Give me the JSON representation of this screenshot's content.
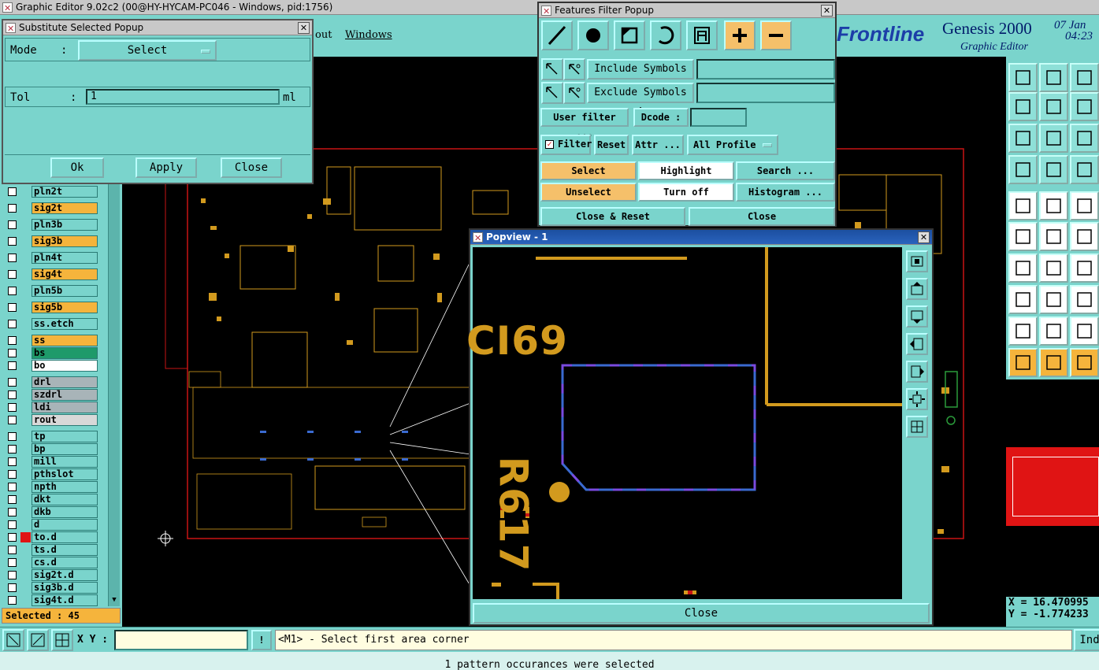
{
  "main_window": {
    "title": "Graphic Editor 9.02c2 (00@HY-HYCAM-PC046 - Windows, pid:1756)"
  },
  "menu": {
    "item_layout": "out",
    "item_windows": "Windows"
  },
  "brand": {
    "logo": "Frontline",
    "product": "Genesis 2000",
    "subtitle": "Graphic Editor",
    "date": "07 Jan",
    "time": "04:23"
  },
  "substitute_popup": {
    "title": "Substitute Selected Popup",
    "mode_label": "Mode",
    "mode_colon": ":",
    "mode_value": "Select",
    "tol_label": "Tol",
    "tol_colon": ":",
    "tol_value": "1",
    "tol_unit": "ml",
    "ok": "Ok",
    "apply": "Apply",
    "close": "Close"
  },
  "features_filter": {
    "title": "Features Filter Popup",
    "include_label": "Include Symbols :",
    "exclude_label": "Exclude Symbols :",
    "user_filter": "User filter ...",
    "dcode_label": "Dcode :",
    "filter_label": "Filter",
    "reset": "Reset",
    "attr": "Attr ...",
    "profile": "All Profile",
    "select": "Select",
    "highlight": "Highlight",
    "search": "Search ...",
    "unselect": "Unselect",
    "turn_off": "Turn off",
    "histogram": "Histogram ...",
    "close_reset": "Close & Reset",
    "close": "Close"
  },
  "popview": {
    "title": "Popview - 1",
    "label1": "CI69",
    "label2": "R617",
    "close": "Close"
  },
  "layers": [
    {
      "name": "pln2t",
      "color": "#7ad4cc"
    },
    {
      "name": "sig2t",
      "color": "#f5b43c"
    },
    {
      "name": "pln3b",
      "color": "#7ad4cc"
    },
    {
      "name": "sig3b",
      "color": "#f5b43c"
    },
    {
      "name": "pln4t",
      "color": "#7ad4cc"
    },
    {
      "name": "sig4t",
      "color": "#f5b43c"
    },
    {
      "name": "pln5b",
      "color": "#7ad4cc"
    },
    {
      "name": "sig5b",
      "color": "#f5b43c"
    },
    {
      "name": "ss.etch",
      "color": "#7ad4cc"
    },
    {
      "name": "ss",
      "color": "#f5b43c"
    },
    {
      "name": "bs",
      "color": "#1e9a6a"
    },
    {
      "name": "bo",
      "color": "#ffffff"
    },
    {
      "name": "drl",
      "color": "#a8b4b8"
    },
    {
      "name": "szdrl",
      "color": "#a8b4b8"
    },
    {
      "name": "ldi",
      "color": "#a8b4b8"
    },
    {
      "name": "rout",
      "color": "#d8d8d8"
    },
    {
      "name": "tp",
      "color": "#7ad4cc"
    },
    {
      "name": "bp",
      "color": "#7ad4cc"
    },
    {
      "name": "mill",
      "color": "#7ad4cc"
    },
    {
      "name": "pthslot",
      "color": "#7ad4cc"
    },
    {
      "name": "npth",
      "color": "#7ad4cc"
    },
    {
      "name": "dkt",
      "color": "#7ad4cc"
    },
    {
      "name": "dkb",
      "color": "#7ad4cc"
    },
    {
      "name": "d",
      "color": "#7ad4cc"
    },
    {
      "name": "to.d",
      "color": "#7ad4cc"
    },
    {
      "name": "ts.d",
      "color": "#7ad4cc"
    },
    {
      "name": "cs.d",
      "color": "#7ad4cc"
    },
    {
      "name": "sig2t.d",
      "color": "#7ad4cc"
    },
    {
      "name": "sig3b.d",
      "color": "#7ad4cc"
    },
    {
      "name": "sig4t.d",
      "color": "#7ad4cc"
    }
  ],
  "status": {
    "selected": "Selected : 45",
    "xy_label": "X Y :",
    "message": "<M1> - Select first area corner",
    "bottom": "1 pattern occurances were selected",
    "ind": "Ind"
  },
  "coords": {
    "x": "X = 16.470995",
    "y": "Y = -1.774233"
  },
  "colors": {
    "bg": "#7ad4cc",
    "orange": "#f5b43c",
    "pcb": "#d29a1e",
    "board_outline": "#c81414"
  }
}
